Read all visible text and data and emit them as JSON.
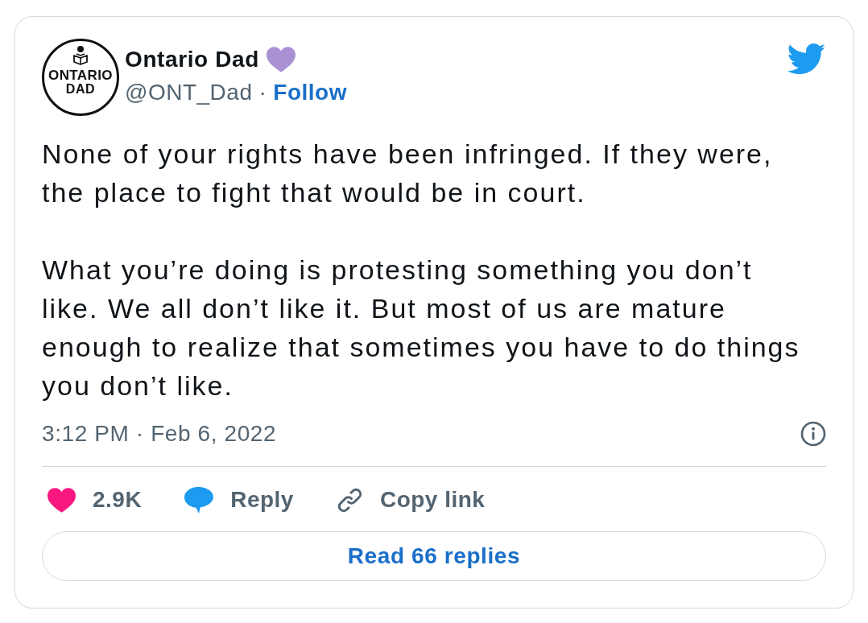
{
  "author": {
    "avatar": {
      "lines": [
        "ONTARIO",
        "DAD"
      ]
    },
    "name": "Ontario Dad",
    "handle": "@ONT_Dad",
    "separator": "·",
    "follow": "Follow"
  },
  "paragraphs": [
    "None of your rights have been infringed. If they were,\nthe place to fight that would be in court.",
    "What you’re doing is protesting something you don’t\nlike. We all don’t like it. But most of us are mature\nenough to realize that sometimes you have to do things\nyou don’t like."
  ],
  "meta": {
    "time": "3:12 PM · Feb 6, 2022"
  },
  "actions": [
    {
      "kind": "like",
      "label": "2.9K"
    },
    {
      "kind": "reply",
      "label": "Reply"
    },
    {
      "kind": "copy_link",
      "label": "Copy link"
    }
  ],
  "read_replies": "Read 66 replies"
}
